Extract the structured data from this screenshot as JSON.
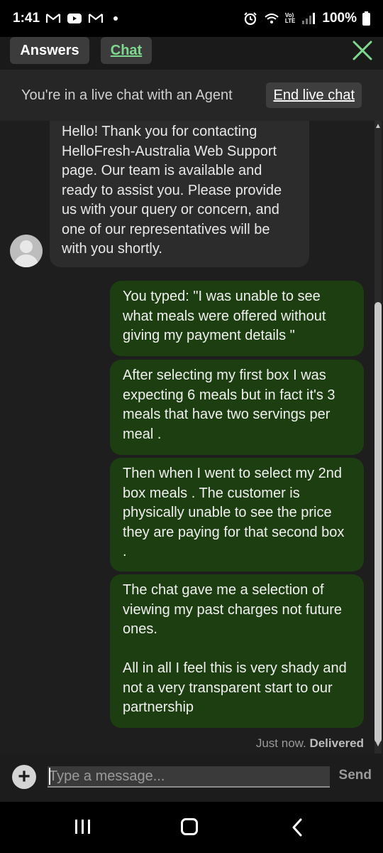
{
  "status_bar": {
    "time": "1:41",
    "notification_icons": [
      "gmail-icon",
      "youtube-icon",
      "gmail-icon",
      "dot"
    ],
    "volte": "Vo)\nLTE",
    "battery": "100%"
  },
  "header": {
    "tabs": [
      {
        "label": "Answers",
        "active": false
      },
      {
        "label": "Chat",
        "active": true
      }
    ],
    "close_icon": "close-icon",
    "accent_color": "#7fd88f"
  },
  "banner": {
    "text": "You're in a live chat with an Agent",
    "end_label": "End live chat"
  },
  "messages": {
    "agent": "Hello! Thank you for contacting HelloFresh-Australia Web Support page. Our team is available and ready to assist you. Please provide us with your query or concern, and one of our representatives will be with you shortly.",
    "user": [
      "You typed: \"I was unable to see what meals were offered without giving my payment details \"",
      "After selecting my first box I was expecting 6 meals but in fact it's 3 meals that have two servings per meal .",
      "Then when I went to select my 2nd box meals . The customer is physically unable to see the price they are paying for that second box .",
      "The chat gave me a selection of viewing my past charges not future ones.\n\nAll in all I feel this is very shady and not a very transparent start to our partnership"
    ],
    "time_label": "Just now.",
    "delivery_status": "Delivered"
  },
  "input": {
    "placeholder": "Type a message...",
    "send_label": "Send",
    "add_icon": "+"
  }
}
